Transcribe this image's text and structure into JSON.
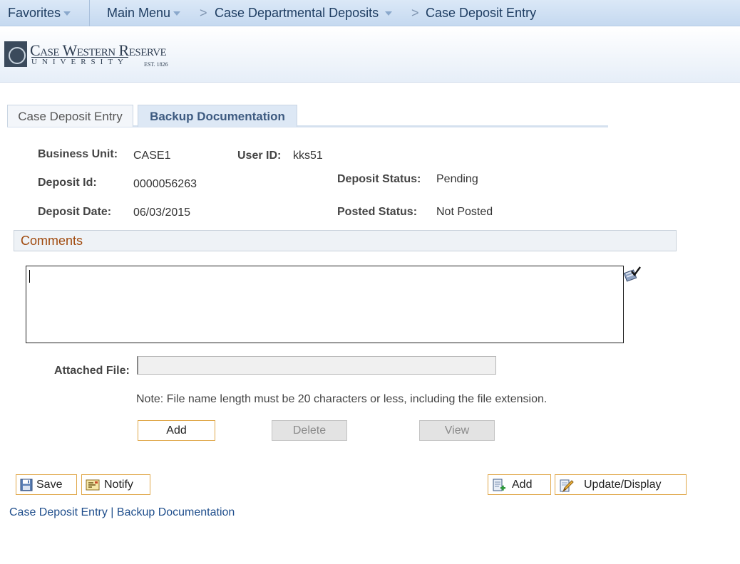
{
  "nav": {
    "favorites": "Favorites",
    "main_menu": "Main Menu",
    "crumb_sep": ">",
    "case_departmental_deposits": "Case Departmental Deposits",
    "case_deposit_entry": "Case Deposit Entry"
  },
  "logo": {
    "line1": "Case Western Reserve",
    "line2": "UNIVERSITY",
    "line3": "EST. 1826"
  },
  "tabs": [
    {
      "label": "Case Deposit Entry",
      "active": false
    },
    {
      "label": "Backup Documentation",
      "active": true
    }
  ],
  "fields": {
    "business_unit_label": "Business Unit:",
    "business_unit_value": "CASE1",
    "user_id_label": "User ID:",
    "user_id_value": "kks51",
    "deposit_id_label": "Deposit Id:",
    "deposit_id_value": "0000056263",
    "deposit_status_label": "Deposit Status:",
    "deposit_status_value": "Pending",
    "deposit_date_label": "Deposit Date:",
    "deposit_date_value": "06/03/2015",
    "posted_status_label": "Posted Status:",
    "posted_status_value": "Not Posted"
  },
  "comments": {
    "header": "Comments",
    "value": ""
  },
  "attachment": {
    "label": "Attached File:",
    "value": "",
    "note": "Note: File name length must be 20 characters or less, including the file extension.",
    "add": "Add",
    "delete": "Delete",
    "view": "View"
  },
  "toolbar": {
    "save": "Save",
    "notify": "Notify",
    "add": "Add",
    "update_display": "Update/Display"
  },
  "footer": {
    "link1": "Case Deposit Entry",
    "separator": " | ",
    "link2": "Backup Documentation"
  },
  "colors": {
    "accent_border": "#e0a84b",
    "section_header": "#a04a0e",
    "link": "#1f4e8c"
  }
}
